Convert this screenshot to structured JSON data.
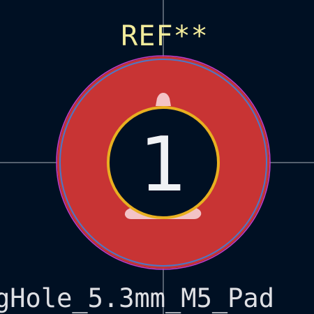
{
  "footprint": {
    "reference": "REF**",
    "value_text": "gHole_5.3mm_M5_Pad",
    "pad_number": "1"
  },
  "colors": {
    "background": "#001023",
    "crosshair": "#c8cdd5",
    "courtyard": "#c03cc8",
    "fab_outline": "#4a78c8",
    "pad_copper": "#c83434",
    "drill_hole": "#001023",
    "hole_outline": "#e8b020",
    "reference_text": "#f2eb9b",
    "value_text": "#dfe0e4",
    "pad_number": "#f0f2f5",
    "silk_marker": "#f3c3c6"
  }
}
